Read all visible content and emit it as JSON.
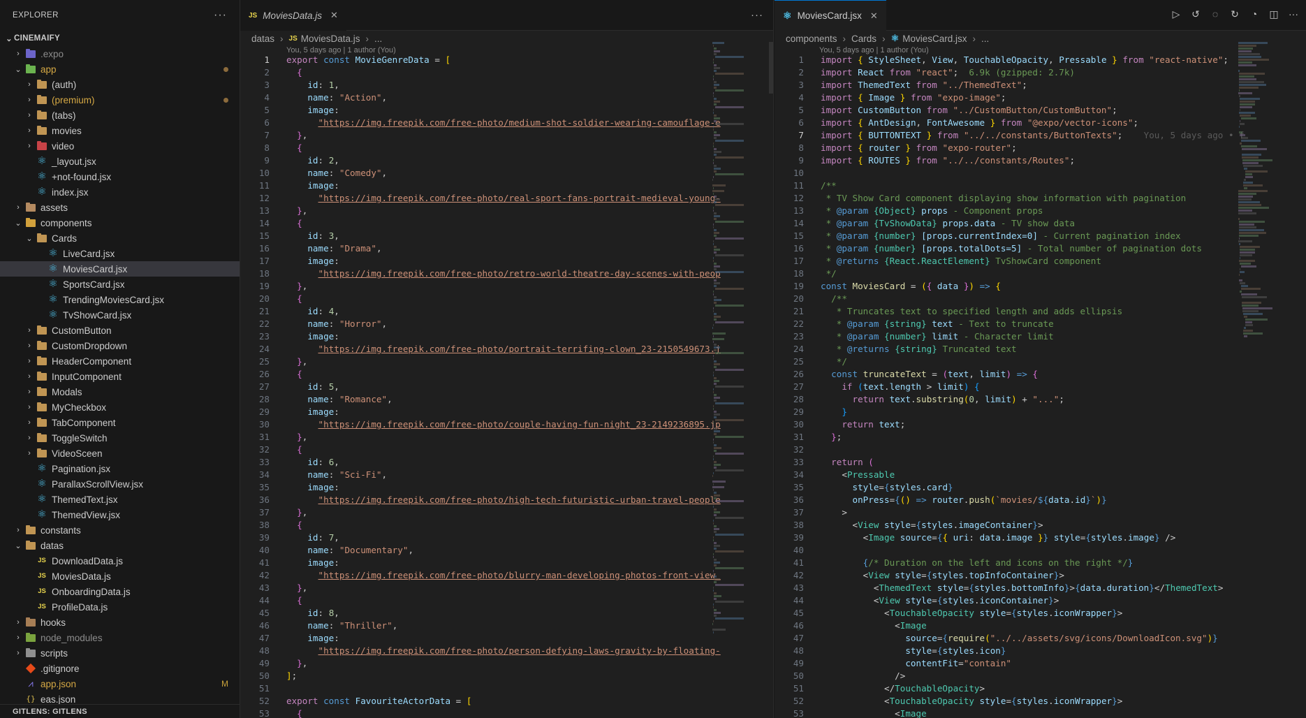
{
  "sidebar": {
    "title": "EXPLORER",
    "more": "···",
    "root": "CINEMAIFY",
    "gitlens": "GITLENS: GITLENS",
    "items": [
      {
        "label": ".expo",
        "depth": 1,
        "chev": ">",
        "icon": "f-expo",
        "kind": "folder",
        "style": "dim"
      },
      {
        "label": "app",
        "depth": 1,
        "chev": "v",
        "icon": "f-app",
        "kind": "folder",
        "style": "yel",
        "badge": true
      },
      {
        "label": "(auth)",
        "depth": 2,
        "chev": ">",
        "icon": "folder",
        "kind": "folder"
      },
      {
        "label": "(premium)",
        "depth": 2,
        "chev": ">",
        "icon": "folder",
        "kind": "folder",
        "style": "yel",
        "badge": true
      },
      {
        "label": "(tabs)",
        "depth": 2,
        "chev": ">",
        "icon": "folder",
        "kind": "folder"
      },
      {
        "label": "movies",
        "depth": 2,
        "chev": ">",
        "icon": "folder",
        "kind": "folder"
      },
      {
        "label": "video",
        "depth": 2,
        "chev": ">",
        "icon": "f-video",
        "kind": "folder"
      },
      {
        "label": "_layout.jsx",
        "depth": 2,
        "icon": "react",
        "kind": "file"
      },
      {
        "label": "+not-found.jsx",
        "depth": 2,
        "icon": "react",
        "kind": "file"
      },
      {
        "label": "index.jsx",
        "depth": 2,
        "icon": "react",
        "kind": "file"
      },
      {
        "label": "assets",
        "depth": 1,
        "chev": ">",
        "icon": "f-assets",
        "kind": "folder"
      },
      {
        "label": "components",
        "depth": 1,
        "chev": "v",
        "icon": "f-comp",
        "kind": "folder"
      },
      {
        "label": "Cards",
        "depth": 2,
        "chev": "v",
        "icon": "folder",
        "kind": "folder"
      },
      {
        "label": "LiveCard.jsx",
        "depth": 3,
        "icon": "react",
        "kind": "file"
      },
      {
        "label": "MoviesCard.jsx",
        "depth": 3,
        "icon": "react",
        "kind": "file",
        "selected": true
      },
      {
        "label": "SportsCard.jsx",
        "depth": 3,
        "icon": "react",
        "kind": "file"
      },
      {
        "label": "TrendingMoviesCard.jsx",
        "depth": 3,
        "icon": "react",
        "kind": "file"
      },
      {
        "label": "TvShowCard.jsx",
        "depth": 3,
        "icon": "react",
        "kind": "file"
      },
      {
        "label": "CustomButton",
        "depth": 2,
        "chev": ">",
        "icon": "folder",
        "kind": "folder"
      },
      {
        "label": "CustomDropdown",
        "depth": 2,
        "chev": ">",
        "icon": "folder",
        "kind": "folder"
      },
      {
        "label": "HeaderComponent",
        "depth": 2,
        "chev": ">",
        "icon": "folder",
        "kind": "folder"
      },
      {
        "label": "InputComponent",
        "depth": 2,
        "chev": ">",
        "icon": "folder",
        "kind": "folder"
      },
      {
        "label": "Modals",
        "depth": 2,
        "chev": ">",
        "icon": "folder",
        "kind": "folder"
      },
      {
        "label": "MyCheckbox",
        "depth": 2,
        "chev": ">",
        "icon": "folder",
        "kind": "folder"
      },
      {
        "label": "TabComponent",
        "depth": 2,
        "chev": ">",
        "icon": "folder",
        "kind": "folder"
      },
      {
        "label": "ToggleSwitch",
        "depth": 2,
        "chev": ">",
        "icon": "folder",
        "kind": "folder"
      },
      {
        "label": "VideoSceen",
        "depth": 2,
        "chev": ">",
        "icon": "folder",
        "kind": "folder"
      },
      {
        "label": "Pagination.jsx",
        "depth": 2,
        "icon": "react",
        "kind": "file"
      },
      {
        "label": "ParallaxScrollView.jsx",
        "depth": 2,
        "icon": "react",
        "kind": "file"
      },
      {
        "label": "ThemedText.jsx",
        "depth": 2,
        "icon": "react",
        "kind": "file"
      },
      {
        "label": "ThemedView.jsx",
        "depth": 2,
        "icon": "react",
        "kind": "file"
      },
      {
        "label": "constants",
        "depth": 1,
        "chev": ">",
        "icon": "folder",
        "kind": "folder"
      },
      {
        "label": "datas",
        "depth": 1,
        "chev": "v",
        "icon": "folder",
        "kind": "folder"
      },
      {
        "label": "DownloadData.js",
        "depth": 2,
        "icon": "jsfile",
        "kind": "file"
      },
      {
        "label": "MoviesData.js",
        "depth": 2,
        "icon": "jsfile",
        "kind": "file"
      },
      {
        "label": "OnboardingData.js",
        "depth": 2,
        "icon": "jsfile",
        "kind": "file"
      },
      {
        "label": "ProfileData.js",
        "depth": 2,
        "icon": "jsfile",
        "kind": "file"
      },
      {
        "label": "hooks",
        "depth": 1,
        "chev": ">",
        "icon": "f-hooks",
        "kind": "folder"
      },
      {
        "label": "node_modules",
        "depth": 1,
        "chev": ">",
        "icon": "f-node",
        "kind": "folder",
        "style": "dim"
      },
      {
        "label": "scripts",
        "depth": 1,
        "chev": ">",
        "icon": "f-scripts",
        "kind": "folder"
      },
      {
        "label": ".gitignore",
        "depth": 1,
        "icon": "git",
        "kind": "file"
      },
      {
        "label": "app.json",
        "depth": 1,
        "icon": "appj",
        "kind": "file",
        "style": "mod",
        "mbadge": "M"
      },
      {
        "label": "eas.json",
        "depth": 1,
        "icon": "jsonf",
        "kind": "file"
      }
    ]
  },
  "left_editor": {
    "tab_label": "MoviesData.js",
    "tab_icon": "JS",
    "more": "···",
    "breadcrumb": [
      "datas",
      "MoviesData.js",
      "..."
    ],
    "blame": "You, 5 days ago | 1 author (You)",
    "lines": [
      "<k>export</k> <kw>const</kw> <v>MovieGenreData</v> = <y>[</y>",
      "  <pk>{</pk>",
      "    <v>id</v>: <n>1</n>,",
      "    <v>name</v>: <s>\"Action\"</s>,",
      "    <v>image</v>:",
      "      <u>\"https://img.freepik.com/free-photo/medium-shot-soldier-wearing-camouflage-e</u>",
      "  <pk>}</pk>,",
      "  <pk>{</pk>",
      "    <v>id</v>: <n>2</n>,",
      "    <v>name</v>: <s>\"Comedy\"</s>,",
      "    <v>image</v>:",
      "      <u>\"https://img.freepik.com/free-photo/real-sport-fans-portrait-medieval-young-</u>",
      "  <pk>}</pk>,",
      "  <pk>{</pk>",
      "    <v>id</v>: <n>3</n>,",
      "    <v>name</v>: <s>\"Drama\"</s>,",
      "    <v>image</v>:",
      "      <u>\"https://img.freepik.com/free-photo/retro-world-theatre-day-scenes-with-peop</u>",
      "  <pk>}</pk>,",
      "  <pk>{</pk>",
      "    <v>id</v>: <n>4</n>,",
      "    <v>name</v>: <s>\"Horror\"</s>,",
      "    <v>image</v>:",
      "      <u>\"https://img.freepik.com/free-photo/portrait-terrifing-clown_23-2150549673.j</u>",
      "  <pk>}</pk>,",
      "  <pk>{</pk>",
      "    <v>id</v>: <n>5</n>,",
      "    <v>name</v>: <s>\"Romance\"</s>,",
      "    <v>image</v>:",
      "      <u>\"https://img.freepik.com/free-photo/couple-having-fun-night_23-2149236895.jp</u>",
      "  <pk>}</pk>,",
      "  <pk>{</pk>",
      "    <v>id</v>: <n>6</n>,",
      "    <v>name</v>: <s>\"Sci-Fi\"</s>,",
      "    <v>image</v>:",
      "      <u>\"https://img.freepik.com/free-photo/high-tech-futuristic-urban-travel-people</u>",
      "  <pk>}</pk>,",
      "  <pk>{</pk>",
      "    <v>id</v>: <n>7</n>,",
      "    <v>name</v>: <s>\"Documentary\"</s>,",
      "    <v>image</v>:",
      "      <u>\"https://img.freepik.com/free-photo/blurry-man-developing-photos-front-view_</u>",
      "  <pk>}</pk>,",
      "  <pk>{</pk>",
      "    <v>id</v>: <n>8</n>,",
      "    <v>name</v>: <s>\"Thriller\"</s>,",
      "    <v>image</v>:",
      "      <u>\"https://img.freepik.com/free-photo/person-defying-laws-gravity-by-floating-</u>",
      "  <pk>}</pk>,",
      "<y>]</y>;",
      "",
      "<k>export</k> <kw>const</kw> <v>FavouriteActorData</v> = <y>[</y>",
      "  <pk>{</pk>"
    ],
    "current_line": 1
  },
  "right_editor": {
    "tab_label": "MoviesCard.jsx",
    "more": "···",
    "breadcrumb": [
      "components",
      "Cards",
      "MoviesCard.jsx",
      "..."
    ],
    "blame": "You, 5 days ago | 1 author (You)",
    "lines": [
      "<k>import</k> <y>{</y> <v>StyleSheet</v>, <v>View</v>, <v>TouchableOpacity</v>, <v>Pressable</v> <y>}</y> <k>from</k> <s>\"react-native\"</s>;",
      "<k>import</k> <v>React</v> <k>from</k> <s>\"react\"</s>;  <hint>6.9k (gzipped: 2.7k)</hint>",
      "<k>import</k> <v>ThemedText</v> <k>from</k> <s>\"../ThemedText\"</s>;",
      "<k>import</k> <y>{</y> <v>Image</v> <y>}</y> <k>from</k> <s>\"expo-image\"</s>;",
      "<k>import</k> <v>CustomButton</v> <k>from</k> <s>\"../CustomButton/CustomButton\"</s>;",
      "<k>import</k> <y>{</y> <v>AntDesign</v>, <v>FontAwesome</v> <y>}</y> <k>from</k> <s>\"@expo/vector-icons\"</s>;",
      "<k>import</k> <y>{</y> <v>BUTTONTEXT</v> <y>}</y> <k>from</k> <s>\"../../constants/ButtonTexts\"</s>;    <ib>You, 5 days ago • f</ib>",
      "<k>import</k> <y>{</y> <v>router</v> <y>}</y> <k>from</k> <s>\"expo-router\"</s>;",
      "<k>import</k> <y>{</y> <v>ROUTES</v> <y>}</y> <k>from</k> <s>\"../../constants/Routes\"</s>;",
      "",
      "<c>/**</c>",
      "<c> * TV Show Card component displaying show information with pagination</c>",
      "<c> * </c><kw>@param</kw> <t>{Object}</t> <v>props</v><c> - Component props</c>",
      "<c> * </c><kw>@param</kw> <t>{TvShowData}</t> <v>props.data</v><c> - TV show data</c>",
      "<c> * </c><kw>@param</kw> <t>{number}</t> <v>[props.currentIndex=0]</v><c> - Current pagination index</c>",
      "<c> * </c><kw>@param</kw> <t>{number}</t> <v>[props.totalDots=5]</v><c> - Total number of pagination dots</c>",
      "<c> * </c><kw>@returns</kw> <t>{React.ReactElement}</t><c> TvShowCard component</c>",
      "<c> */</c>",
      "<kw>const</kw> <f>MoviesCard</f> = <y>(</y><pk>{</pk> <v>data</v> <pk>}</pk><y>)</y> <kw>=&gt;</kw> <y>{</y>",
      "  <c>/**</c>",
      "<c>   * Truncates text to specified length and adds ellipsis</c>",
      "<c>   * </c><kw>@param</kw> <t>{string}</t> <v>text</v><c> - Text to truncate</c>",
      "<c>   * </c><kw>@param</kw> <t>{number}</t> <v>limit</v><c> - Character limit</c>",
      "<c>   * </c><kw>@returns</kw> <t>{string}</t><c> Truncated text</c>",
      "<c>   */</c>",
      "  <kw>const</kw> <f>truncateText</f> = <pk>(</pk><v>text</v>, <v>limit</v><pk>)</pk> <kw>=&gt;</kw> <pk>{</pk>",
      "    <k>if</k> <bl>(</bl><v>text</v>.<v>length</v> &gt; <v>limit</v><bl>)</bl> <bl>{</bl>",
      "      <k>return</k> <v>text</v>.<f>substring</f><y>(</y><n>0</n>, <v>limit</v><y>)</y> + <s>\"...\"</s>;",
      "    <bl>}</bl>",
      "    <k>return</k> <v>text</v>;",
      "  <pk>}</pk>;",
      "",
      "  <k>return</k> <pk>(</pk>",
      "    <p>&lt;</p><t>Pressable</t>",
      "      <v>style</v>=<kw>{</kw><v>styles</v>.<v>card</v><kw>}</kw>",
      "      <v>onPress</v>=<kw>{</kw><y>()</y> <kw>=&gt;</kw> <v>router</v>.<f>push</f><y>(</y><s>`movies/</s><kw>${</kw><v>data</v>.<v>id</v><kw>}</kw><s>`</s><y>)</y><kw>}</kw>",
      "    <p>&gt;</p>",
      "      <p>&lt;</p><t>View</t> <v>style</v>=<kw>{</kw><v>styles</v>.<v>imageContainer</v><kw>}</kw><p>&gt;</p>",
      "        <p>&lt;</p><t>Image</t> <v>source</v>=<kw>{</kw><y>{</y> <v>uri</v>: <v>data</v>.<v>image</v> <y>}</y><kw>}</kw> <v>style</v>=<kw>{</kw><v>styles</v>.<v>image</v><kw>}</kw> <p>/&gt;</p>",
      "",
      "        <kw>{</kw><c>/* Duration on the left and icons on the right */</c><kw>}</kw>",
      "        <p>&lt;</p><t>View</t> <v>style</v>=<kw>{</kw><v>styles</v>.<v>topInfoContainer</v><kw>}</kw><p>&gt;</p>",
      "          <p>&lt;</p><t>ThemedText</t> <v>style</v>=<kw>{</kw><v>styles</v>.<v>bottomInfo</v><kw>}</kw><p>&gt;</p><kw>{</kw><v>data</v>.<v>duration</v><kw>}</kw><p>&lt;/</p><t>ThemedText</t><p>&gt;</p>",
      "          <p>&lt;</p><t>View</t> <v>style</v>=<kw>{</kw><v>styles</v>.<v>iconContainer</v><kw>}</kw><p>&gt;</p>",
      "            <p>&lt;</p><t>TouchableOpacity</t> <v>style</v>=<kw>{</kw><v>styles</v>.<v>iconWrapper</v><kw>}</kw><p>&gt;</p>",
      "              <p>&lt;</p><t>Image</t>",
      "                <v>source</v>=<kw>{</kw><f>require</f><y>(</y><s>\"../../assets/svg/icons/DownloadIcon.svg\"</s><y>)</y><kw>}</kw>",
      "                <v>style</v>=<kw>{</kw><v>styles</v>.<v>icon</v><kw>}</kw>",
      "                <v>contentFit</v>=<s>\"contain\"</s>",
      "              <p>/&gt;</p>",
      "            <p>&lt;/</p><t>TouchableOpacity</t><p>&gt;</p>",
      "            <p>&lt;</p><t>TouchableOpacity</t> <v>style</v>=<kw>{</kw><v>styles</v>.<v>iconWrapper</v><kw>}</kw><p>&gt;</p>",
      "              <p>&lt;</p><t>Image</t>"
    ],
    "current_line": 7
  },
  "icons": {
    "run": "play-icon",
    "toggle_changes": "git-compare-icon",
    "prev": "go-back-icon",
    "next": "go-forward-icon",
    "timeline": "timeline-icon",
    "split": "split-editor-icon",
    "more": "more-actions-icon"
  }
}
